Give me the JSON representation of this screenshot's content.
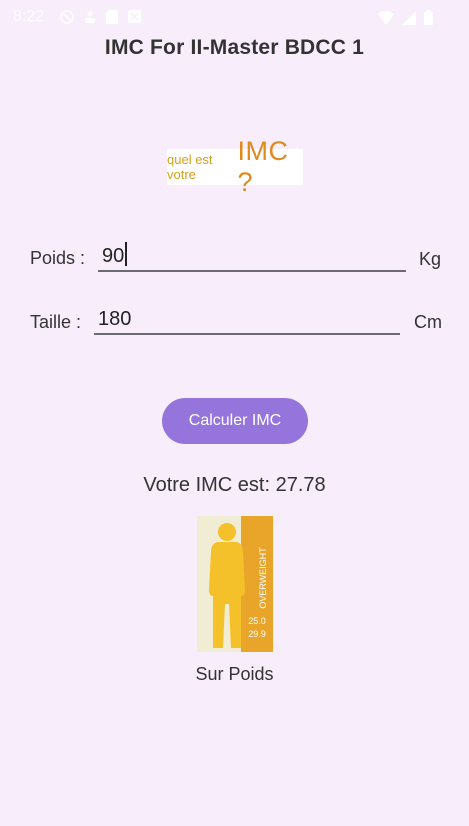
{
  "status_bar": {
    "time": "8:22"
  },
  "app": {
    "title": "IMC For II-Master BDCC 1"
  },
  "logo": {
    "small_text": "quel est votre",
    "big_text": "IMC ?"
  },
  "form": {
    "weight": {
      "label": "Poids :",
      "value": "90",
      "unit": "Kg"
    },
    "height": {
      "label": "Taille :",
      "value": "180",
      "unit": "Cm"
    }
  },
  "actions": {
    "calculate_label": "Calculer IMC"
  },
  "result": {
    "text": "Votre IMC est: 27.78"
  },
  "bmi_image": {
    "category_text": "OVERWEIGHT",
    "range_low": "25.0",
    "range_high": "29.9"
  },
  "category": {
    "label": "Sur Poids"
  },
  "colors": {
    "background": "#f7edfb",
    "button": "#9575db",
    "figure": "#f5c12a",
    "panel": "#e8a52a"
  }
}
